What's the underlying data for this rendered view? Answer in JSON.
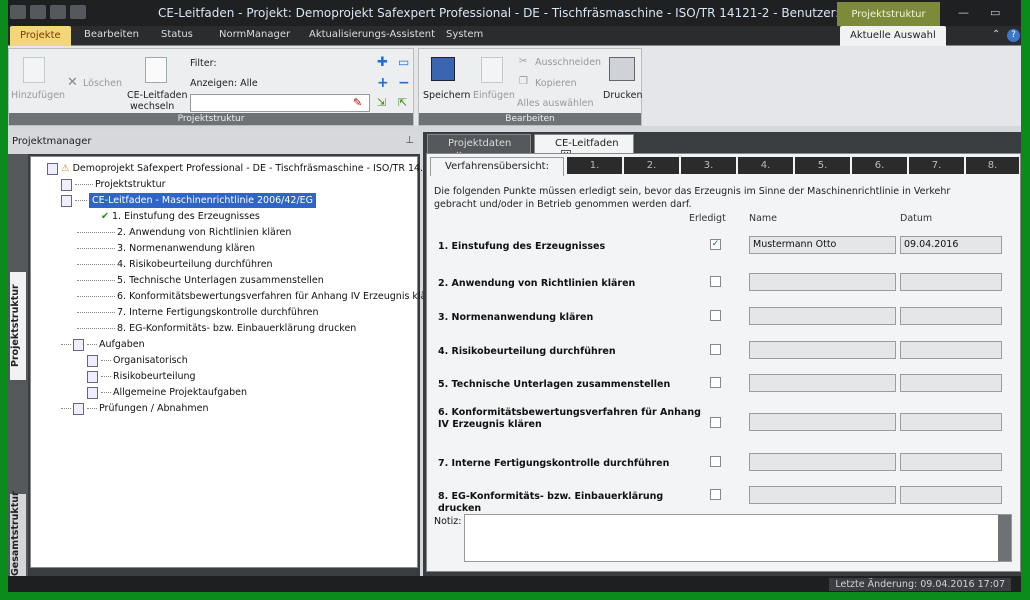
{
  "title_bar": {
    "title": "CE-Leitfaden - Projekt: Demoprojekt Safexpert Professional -  DE - Tischfräsmaschine - ISO/TR 14121-2 -  Benutzer: Must...",
    "context_tab": "Projektstruktur"
  },
  "menu": {
    "tabs": [
      "Projekte",
      "Bearbeiten",
      "Status",
      "NormManager",
      "Aktualisierungs-Assistent",
      "System"
    ],
    "context_tab": "Aktuelle Auswahl"
  },
  "ribbon": {
    "group1": {
      "label": "Projektstruktur",
      "add": "Hinzufügen",
      "delete": "Löschen",
      "switch_line1": "CE-Leitfaden",
      "switch_line2": "wechseln",
      "filter_label": "Filter:",
      "show_label": "Anzeigen: Alle"
    },
    "group2": {
      "label": "Bearbeiten",
      "save": "Speichern",
      "paste": "Einfügen",
      "cut": "Ausschneiden",
      "copy": "Kopieren",
      "select_all": "Alles auswählen",
      "print": "Drucken"
    }
  },
  "left_panel": {
    "title": "Projektmanager",
    "vtab_project": "Projektstruktur",
    "vtab_total": "Gesamtstruktur",
    "tree": {
      "root": "Demoprojekt Safexpert Professional  -  DE - Tischfräsmaschine - ISO/TR 14...",
      "projektstruktur": "Projektstruktur",
      "ce_leitfaden": "CE-Leitfaden - Maschinenrichtlinie 2006/42/EG",
      "steps": [
        "1. Einstufung des Erzeugnisses",
        "2. Anwendung von Richtlinien klären",
        "3. Normenanwendung klären",
        "4. Risikobeurteilung durchführen",
        "5. Technische Unterlagen zusammenstellen",
        "6. Konformitätsbewertungsverfahren für Anhang IV Erzeugnis klären",
        "7. Interne Fertigungskontrolle durchführen",
        "8. EG-Konformitäts- bzw. Einbauerklärung drucken"
      ],
      "aufgaben": "Aufgaben",
      "sub_tasks": [
        "Organisatorisch",
        "Risikobeurteilung",
        "Allgemeine Projektaufgaben"
      ],
      "pruefungen": "Prüfungen / Abnahmen"
    }
  },
  "right_panel": {
    "doc_tabs": [
      "Projektdaten",
      "CE-Leitfaden"
    ],
    "page_tabs": [
      "Verfahrensübersicht:",
      "1.",
      "2.",
      "3.",
      "4.",
      "5.",
      "6.",
      "7.",
      "8."
    ],
    "intro": "Die folgenden Punkte müssen erledigt sein, bevor das Erzeugnis im Sinne der Maschinenrichtlinie in Verkehr gebracht und/oder in Betrieb genommen werden darf.",
    "col_done": "Erledigt",
    "col_name": "Name",
    "col_date": "Datum",
    "rows": [
      {
        "label": "1. Einstufung des Erzeugnisses",
        "done": "✓",
        "name": "Mustermann Otto",
        "date": "09.04.2016"
      },
      {
        "label": "2. Anwendung von Richtlinien klären",
        "done": "",
        "name": "",
        "date": ""
      },
      {
        "label": "3. Normenanwendung klären",
        "done": "",
        "name": "",
        "date": ""
      },
      {
        "label": "4. Risikobeurteilung durchführen",
        "done": "",
        "name": "",
        "date": ""
      },
      {
        "label": "5. Technische Unterlagen zusammenstellen",
        "done": "",
        "name": "",
        "date": ""
      },
      {
        "label": "6. Konformitätsbewertungsverfahren für Anhang IV Erzeugnis klären",
        "done": "",
        "name": "",
        "date": ""
      },
      {
        "label": "7. Interne Fertigungskontrolle durchführen",
        "done": "",
        "name": "",
        "date": ""
      },
      {
        "label": "8. EG-Konformitäts- bzw. Einbauerklärung drucken",
        "done": "",
        "name": "",
        "date": ""
      }
    ],
    "notiz_label": "Notiz:"
  },
  "status": {
    "text": "Letzte Änderung: 09.04.2016 17:07"
  }
}
